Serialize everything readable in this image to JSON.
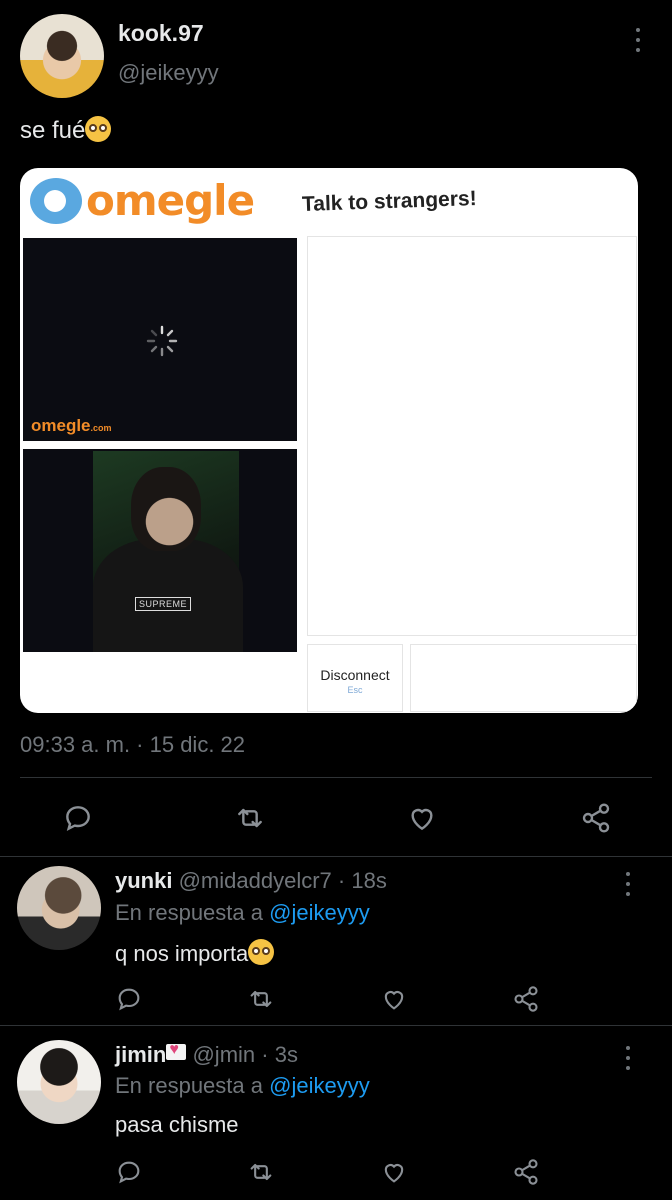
{
  "tweet": {
    "author_name": "kook.97",
    "author_handle": "@jeikeyyy",
    "text": "se fué",
    "timestamp": "09:33 a. m. · 15 dic. 22",
    "media": {
      "logo_text": "omegle",
      "tagline": "Talk to strangers!",
      "watermark": "omegle",
      "watermark_suffix": ".com",
      "shirt_text": "SUPREME",
      "disconnect_label": "Disconnect",
      "disconnect_hint": "Esc"
    }
  },
  "replies": [
    {
      "name": "yunki",
      "handle": "@midaddyelcr7",
      "time": "· 18s",
      "reply_prefix": "En respuesta a",
      "reply_to": "@jeikeyyy",
      "text": "q nos importa"
    },
    {
      "name": "jimin",
      "handle": "@jmin",
      "time": "· 3s",
      "reply_prefix": "En respuesta a",
      "reply_to": "@jeikeyyy",
      "text": "pasa chisme"
    }
  ],
  "icons": [
    "more-icon",
    "reply-icon",
    "retweet-icon",
    "like-icon",
    "share-icon",
    "pleading-face-emoji",
    "heart-letter-emoji",
    "loading-spinner-icon"
  ],
  "colors": {
    "background": "#000000",
    "accent": "#1d9bf0",
    "muted": "#71767b",
    "omegle_orange": "#f28c28",
    "omegle_blue": "#5aa8e0"
  }
}
